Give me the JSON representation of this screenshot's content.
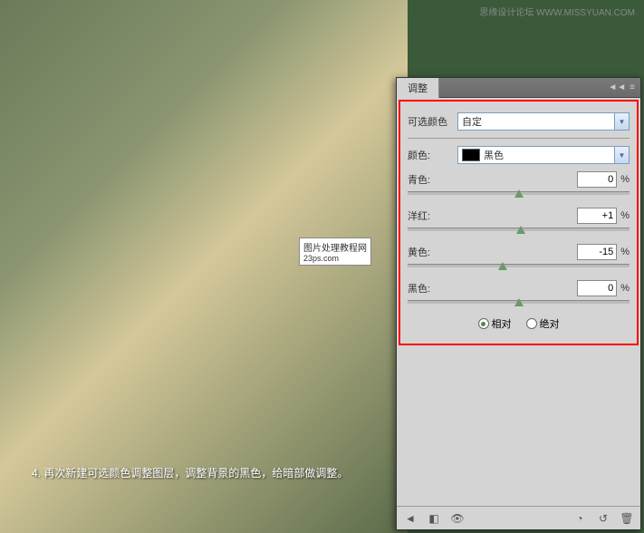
{
  "watermark": {
    "site_name": "思缘设计论坛",
    "site_url": "WWW.MISSYUAN.COM"
  },
  "center_overlay": {
    "text": "图片处理教程网",
    "subtext": "23ps.com"
  },
  "caption": "4. 再次新建可选颜色调整图层，调整背景的黑色，给暗部做调整。",
  "panel": {
    "tab": "调整",
    "menu_tip": "≡",
    "preset_label": "可选颜色",
    "preset_value": "自定",
    "color_label": "颜色:",
    "color_value": "黑色",
    "sliders": [
      {
        "label": "青色:",
        "value": "0",
        "pos": 50
      },
      {
        "label": "洋红:",
        "value": "+1",
        "pos": 51
      },
      {
        "label": "黄色:",
        "value": "-15",
        "pos": 43
      },
      {
        "label": "黑色:",
        "value": "0",
        "pos": 50
      }
    ],
    "pct": "%",
    "radio_relative": "相对",
    "radio_absolute": "绝对"
  }
}
